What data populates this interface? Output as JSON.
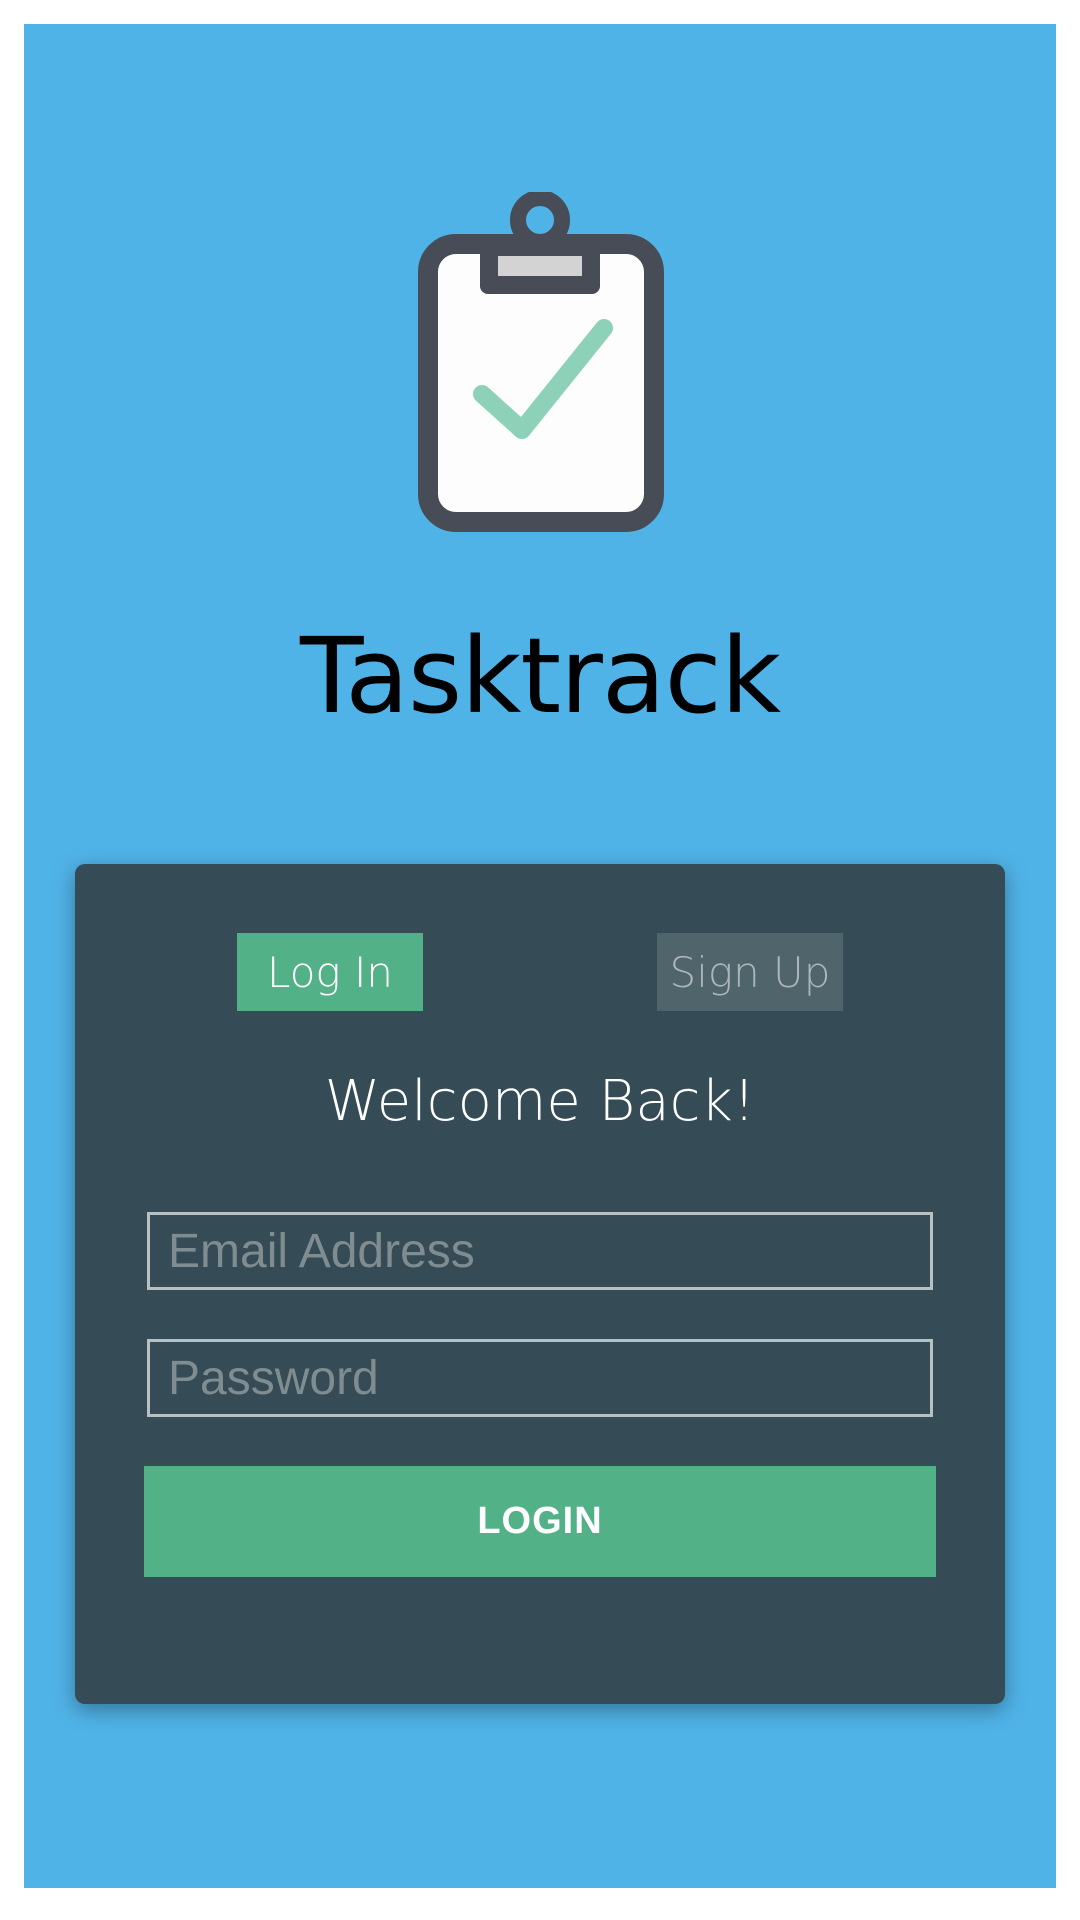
{
  "app": {
    "title": "Tasktrack",
    "logo_icon": "clipboard-check-icon"
  },
  "auth": {
    "tabs": [
      {
        "label": "Log In",
        "active": true
      },
      {
        "label": "Sign Up",
        "active": false
      }
    ],
    "heading": "Welcome Back!",
    "email_placeholder": "Email Address",
    "password_placeholder": "Password",
    "submit_label": "LOGIN"
  },
  "colors": {
    "background": "#50b3e8",
    "card": "#354b55",
    "accent_green": "#53b188",
    "inactive_tab": "#50646b"
  }
}
